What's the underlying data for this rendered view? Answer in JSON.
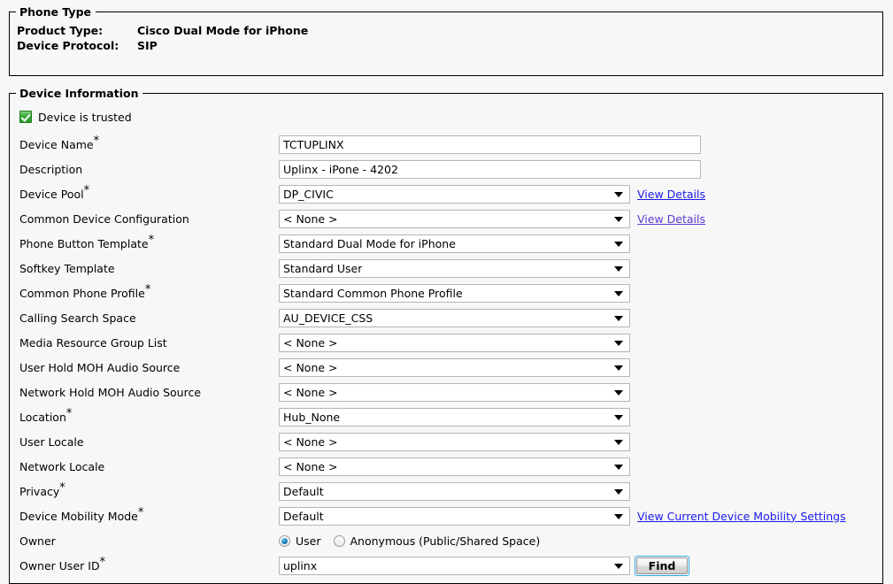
{
  "phone_type": {
    "legend": "Phone Type",
    "rows": [
      {
        "label": "Product Type:",
        "value": "Cisco Dual Mode for iPhone"
      },
      {
        "label": "Device Protocol:",
        "value": "SIP"
      }
    ]
  },
  "device_information": {
    "legend": "Device Information",
    "trusted": {
      "label": "Device is trusted",
      "checked": true,
      "icon": "green-check-icon"
    },
    "fields": [
      {
        "label": "Device Name",
        "required": true,
        "type": "text",
        "value": "TCTUPLINX"
      },
      {
        "label": "Description",
        "required": false,
        "type": "text",
        "value": "Uplinx - iPone - 4202"
      },
      {
        "label": "Device Pool",
        "required": true,
        "type": "select",
        "value": "DP_CIVIC",
        "link": "View Details",
        "link_visited": false
      },
      {
        "label": "Common Device Configuration",
        "required": false,
        "type": "select",
        "value": "< None >",
        "link": "View Details",
        "link_visited": true
      },
      {
        "label": "Phone Button Template",
        "required": true,
        "type": "select",
        "value": "Standard Dual Mode for iPhone"
      },
      {
        "label": "Softkey Template",
        "required": false,
        "type": "select",
        "value": "Standard User"
      },
      {
        "label": "Common Phone Profile",
        "required": true,
        "type": "select",
        "value": "Standard Common Phone Profile"
      },
      {
        "label": "Calling Search Space",
        "required": false,
        "type": "select",
        "value": "AU_DEVICE_CSS"
      },
      {
        "label": "Media Resource Group List",
        "required": false,
        "type": "select",
        "value": "< None >"
      },
      {
        "label": "User Hold MOH Audio Source",
        "required": false,
        "type": "select",
        "value": "< None >"
      },
      {
        "label": "Network Hold MOH Audio Source",
        "required": false,
        "type": "select",
        "value": "< None >"
      },
      {
        "label": "Location",
        "required": true,
        "type": "select",
        "value": "Hub_None"
      },
      {
        "label": "User Locale",
        "required": false,
        "type": "select",
        "value": "< None >"
      },
      {
        "label": "Network Locale",
        "required": false,
        "type": "select",
        "value": "< None >"
      },
      {
        "label": "Privacy",
        "required": true,
        "type": "select",
        "value": "Default"
      },
      {
        "label": "Device Mobility Mode",
        "required": true,
        "type": "select",
        "value": "Default",
        "link": "View Current Device Mobility Settings",
        "link_visited": false
      }
    ],
    "owner": {
      "label": "Owner",
      "options": [
        {
          "label": "User",
          "selected": true
        },
        {
          "label": "Anonymous (Public/Shared Space)",
          "selected": false
        }
      ]
    },
    "owner_user_id": {
      "label": "Owner User ID",
      "required": true,
      "value": "uplinx",
      "find_button": "Find"
    }
  },
  "colors": {
    "link": "#1a1aee",
    "link_visited": "#5c3ad6",
    "checkbox_green": "#36aa36",
    "radio_blue": "#1577b5",
    "button_border": "#2fa8e0",
    "page_background": "#f7f7f7"
  }
}
